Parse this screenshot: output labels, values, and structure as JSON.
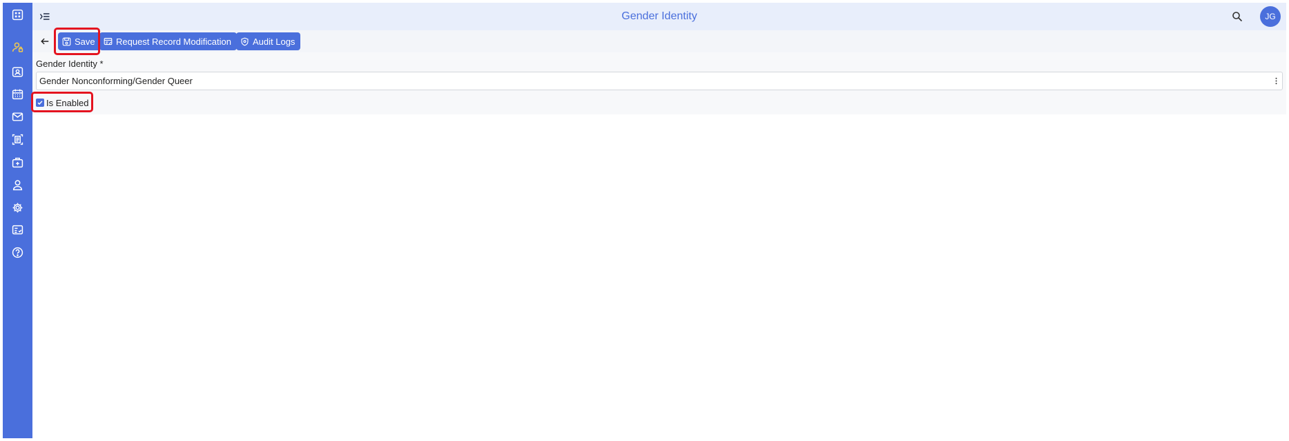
{
  "header": {
    "title": "Gender Identity",
    "avatar_initials": "JG"
  },
  "toolbar": {
    "save_label": "Save",
    "request_label": "Request Record Modification",
    "audit_label": "Audit Logs"
  },
  "form": {
    "field_label": "Gender Identity *",
    "field_value": "Gender Nonconforming/Gender Queer",
    "checkbox_label": "Is Enabled",
    "checkbox_checked": true
  },
  "sidebar": {
    "icons": [
      "apps-icon",
      "user-lock-icon",
      "contact-card-icon",
      "calendar-icon",
      "mail-icon",
      "document-scan-icon",
      "medical-kit-icon",
      "person-icon",
      "settings-icon",
      "checklist-icon",
      "help-icon"
    ]
  },
  "colors": {
    "accent": "#4a6fdc",
    "topbar_bg": "#e8eefb",
    "active_icon": "#f2c94c",
    "highlight": "#e4131f"
  }
}
